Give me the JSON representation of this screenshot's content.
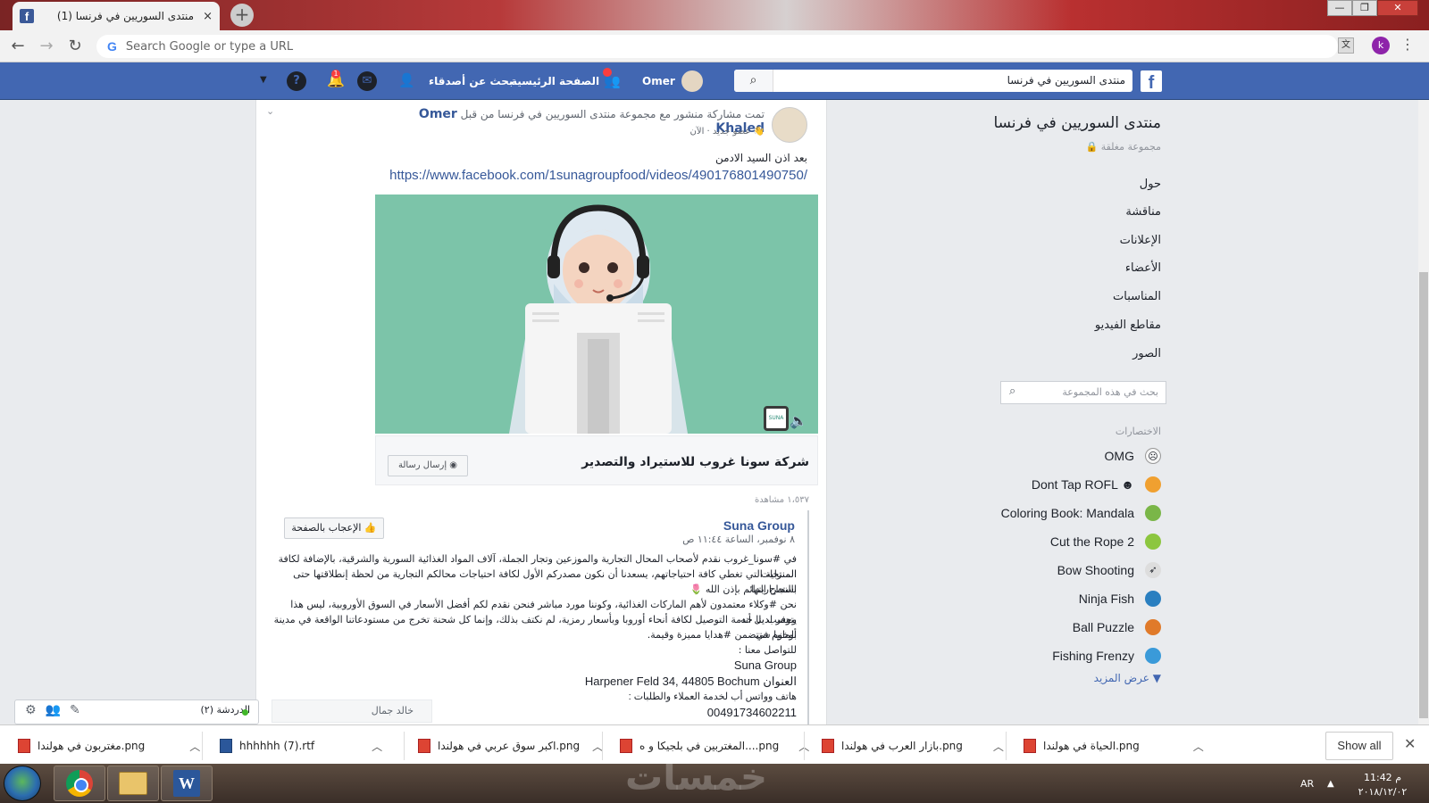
{
  "browser": {
    "tab_title": "(1) منتدى السوريين في فرنسا",
    "tab_close": "×",
    "new_tab": "+",
    "omnibox_placeholder": "Search Google or type a URL",
    "profile_initial": "k",
    "window_controls": [
      "—",
      "❐",
      "✕"
    ]
  },
  "fb_header": {
    "logo": "f",
    "search_value": "منتدى السوريين في فرنسا",
    "user_name": "Omer",
    "home": "الصفحة الرئيسية",
    "find_friends": "بحث عن أصدقاء",
    "notifications_count": "1",
    "icons": [
      "search-icon",
      "friend-requests-icon",
      "messenger-icon",
      "notifications-icon",
      "help-icon",
      "account-menu-icon"
    ]
  },
  "sidebar": {
    "group_title": "منتدى السوريين في فرنسا",
    "group_status": "مجموعة مغلقة 🔒",
    "nav": [
      "حول",
      "مناقشة",
      "الإعلانات",
      "الأعضاء",
      "المناسبات",
      "مقاطع الفيديو",
      "الصور"
    ],
    "search_placeholder": "بحث في هذه المجموعة",
    "shortcuts_label": "الاختصارات",
    "shortcuts": [
      {
        "label": "OMG",
        "icon": "omg-icon",
        "color": "#f5f5f5"
      },
      {
        "label": "Dont Tap ROFL ☻",
        "icon": "rofl-icon",
        "color": "#f0a030"
      },
      {
        "label": "Coloring Book: Mandala",
        "icon": "mandala-icon",
        "color": "#7ab648"
      },
      {
        "label": "Cut the Rope 2",
        "icon": "om-nom-icon",
        "color": "#8cc63f"
      },
      {
        "label": "Bow Shooting",
        "icon": "bow-icon",
        "color": "#dddddd"
      },
      {
        "label": "Ninja Fish",
        "icon": "ninja-fish-icon",
        "color": "#2a7fc0"
      },
      {
        "label": "Ball Puzzle",
        "icon": "ball-puzzle-icon",
        "color": "#e07a2a"
      },
      {
        "label": "Fishing Frenzy",
        "icon": "fishing-icon",
        "color": "#3a9ad9"
      }
    ],
    "show_more": "عرض المزيد"
  },
  "post": {
    "author": "Omer Khaled",
    "share_text": "تمت مشاركة منشور مع مجموعة منتدى السوريين في فرنسا من قبل",
    "member_line": "عضو جديد · الآن",
    "body": "بعد اذن السيد الادمن",
    "link": "https://www.facebook.com/1sunagroupfood/videos/490176801490750/",
    "page_name": "شركة سونا غروب للاستيراد والتصدير",
    "send_message": "إرسال رسالة",
    "video_badge": "SUNA",
    "views": "١،٥٣٧ مشاهدة",
    "shared": {
      "name": "Suna Group",
      "time": "٨ نوفمبر، الساعة ١١:٤٤ ص",
      "like_page": "الإعجاب بالصفحة",
      "paragraphs": [
        "في #سونا_غروب نقدم لأصحاب المحال التجارية والموزعين وتجار الجملة، آلاف المواد الغذائية السورية والشرقية، بالإضافة لكافة المنتجات",
        "المنزلية التي تغطي كافة احتياجاتهم، يسعدنا أن نكون مصدركم الأول لكافة احتياجات محالكم التجارية من لحظة إنطلاقتها حتى استمراريتها",
        "بالنجاح الدائم بإذن الله 🌷",
        "نحن #وكلاء معتمدون لأهم الماركات الغذائية، وكوننا مورد مباشر فنحن نقدم لكم أفضل الأسعار في السوق الأوروبية، ليس هذا وحسب بل أنه",
        "يتوفر لدينا خدمة التوصيل لكافة أنحاء أوروبا وبأسعار رمزية، لم نكتف بذلك، وإنما كل شحنة تخرج من مستودعاتنا الواقعة في مدينة بوخوم في",
        "ألمانيا ستتضمن #هدايا مميزة وقيمة.",
        "للتواصل معنا :"
      ],
      "contact": [
        "Suna Group",
        "العنوان Harpener Feld 34, 44805 Bochum",
        "هاتف وواتس أب لخدمة العملاء والطلبات :",
        "00491734602211"
      ]
    }
  },
  "chat": {
    "label": "الدردشة (٢)",
    "user": "خالد جمال"
  },
  "downloads": {
    "items": [
      {
        "name": "مغتربون في هولندا.png",
        "type": "png"
      },
      {
        "name": "hhhhhh (7).rtf",
        "type": "rtf"
      },
      {
        "name": "اكبر سوق عربي في هولندا.png",
        "type": "png"
      },
      {
        "name": "المغتربين في بلجيكا و ه....png",
        "type": "png"
      },
      {
        "name": "بازار العرب في هولندا.png",
        "type": "png"
      },
      {
        "name": "الحياة في هولندا.png",
        "type": "png"
      }
    ],
    "show_all": "Show all",
    "close": "✕"
  },
  "taskbar": {
    "lang": "AR",
    "time": "11:42 م",
    "date": "٢٠١٨/١٢/٠٢"
  },
  "watermark": "خمسات"
}
